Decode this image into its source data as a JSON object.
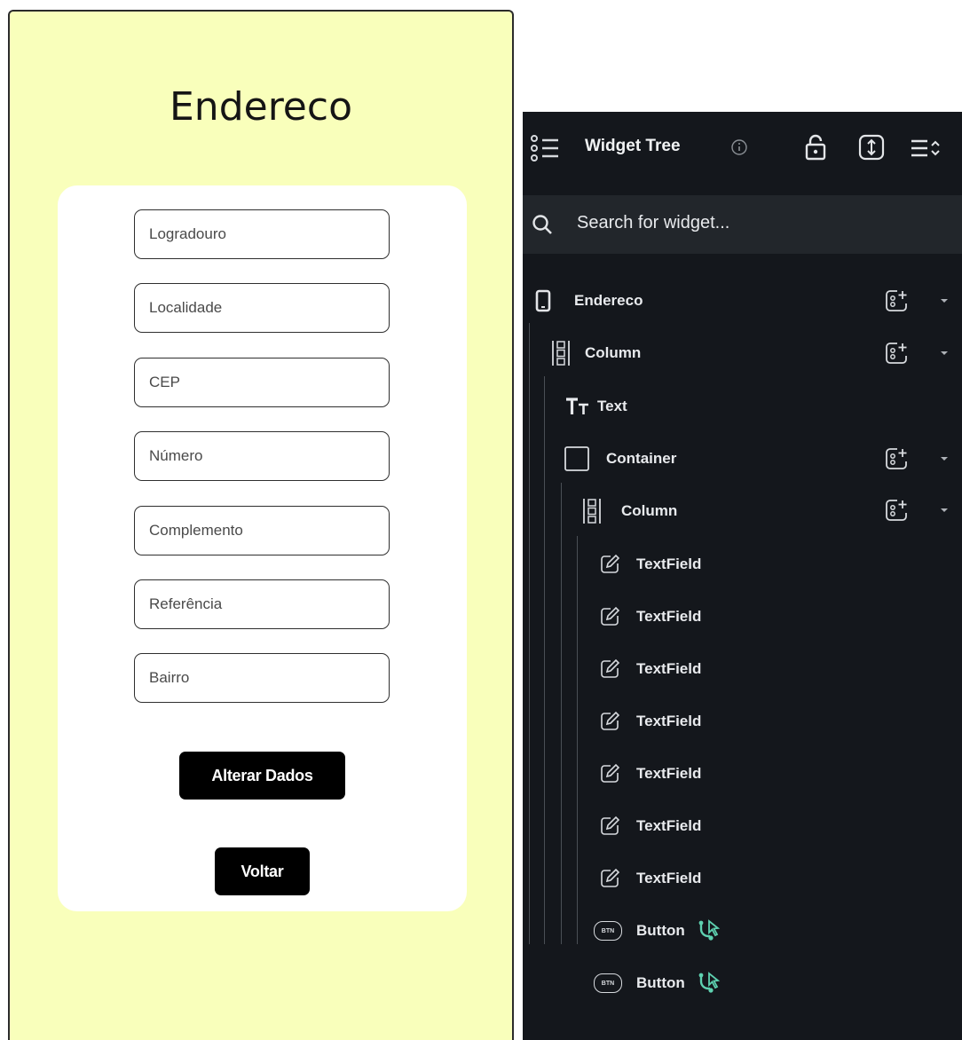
{
  "phone": {
    "title": "Endereco",
    "fields": [
      "Logradouro",
      "Localidade",
      "CEP",
      "Número",
      "Complemento",
      "Referência",
      "Bairro"
    ],
    "buttons": {
      "alterar": "Alterar Dados",
      "voltar": "Voltar"
    },
    "background_color": "#f9ffbb"
  },
  "panel": {
    "title": "Widget Tree",
    "search_placeholder": "Search for widget...",
    "tree": {
      "root": "Endereco",
      "column1": "Column",
      "text": "Text",
      "container": "Container",
      "column2": "Column",
      "textfields": [
        "TextField",
        "TextField",
        "TextField",
        "TextField",
        "TextField",
        "TextField",
        "TextField"
      ],
      "buttons": [
        "Button",
        "Button"
      ],
      "btn_badge": "BTN"
    },
    "accent_color": "#5ed1b0"
  }
}
